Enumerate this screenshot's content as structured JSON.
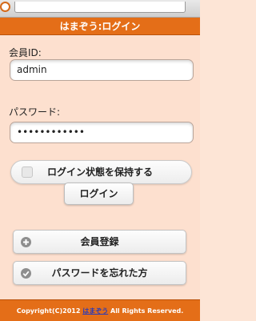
{
  "header": {
    "title": "はまぞう:ログイン"
  },
  "form": {
    "member_id_label": "会員ID:",
    "member_id_value": "admin",
    "password_label": "パスワード:",
    "password_value": "••••••••••••",
    "remember_label": "ログイン状態を保持する",
    "remember_checked": false,
    "login_button": "ログイン"
  },
  "links": {
    "register": {
      "label": "会員登録",
      "icon": "plus-icon"
    },
    "forgot_password": {
      "label": "パスワードを忘れた方",
      "icon": "check-icon"
    }
  },
  "footer": {
    "copyright_prefix": "Copyright(C)2012",
    "brand_link": "はまぞう",
    "rights": "All Rights Reserved."
  },
  "colors": {
    "accent": "#e46e18",
    "background": "#fde0cf",
    "link": "#2a3bb8"
  }
}
